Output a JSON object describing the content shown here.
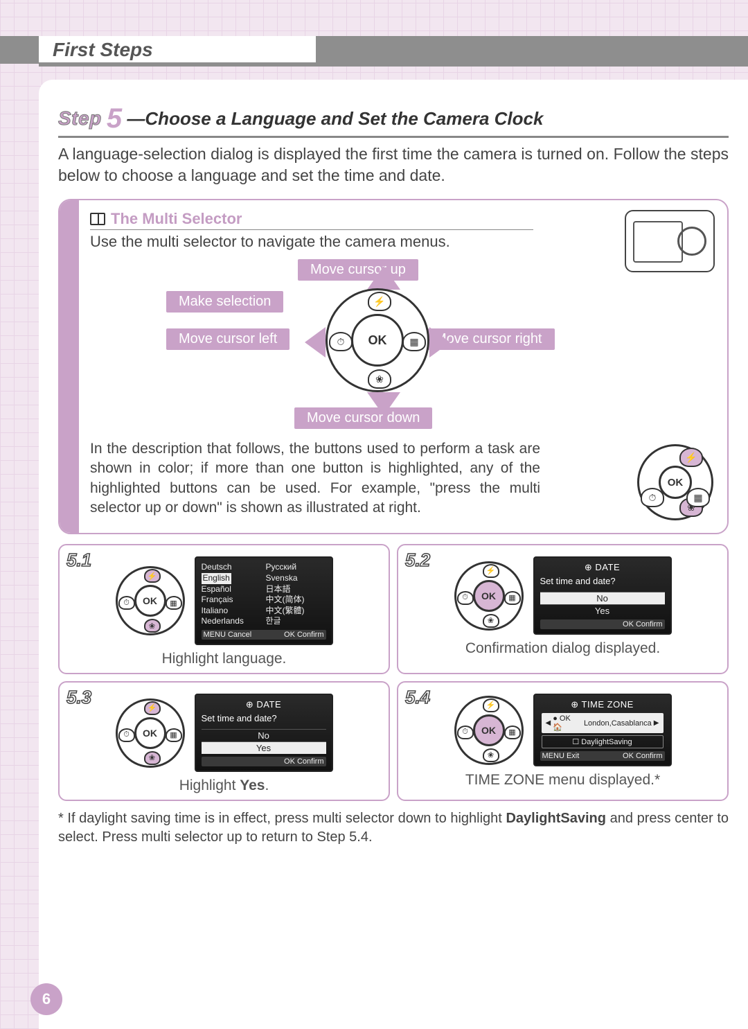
{
  "chapter": "First Steps",
  "step_word": "Step",
  "step_number": "5",
  "step_title": "—Choose a Language and Set the Camera Clock",
  "intro": "A language-selection dialog is displayed the first time the camera is turned on. Follow the steps below to choose a language and set the time and date.",
  "selector": {
    "heading": "The Multi Selector",
    "sub": "Use the multi selector to navigate the camera menus.",
    "labels": {
      "up": "Move cursor up",
      "down": "Move cursor down",
      "left": "Move cursor left",
      "right": "Move cursor right",
      "select": "Make selection"
    },
    "ok": "OK",
    "para": "In the description that follows, the buttons used to perform a task are shown in color; if more than one button is highlighted, any of the highlighted buttons can be used.  For example, \"press the multi selector up or down\" is shown as illustrated at right."
  },
  "steps": {
    "s51": {
      "num": "5.1",
      "caption": "Highlight language.",
      "lcd": {
        "col1": [
          "Deutsch",
          "English",
          "Español",
          "Français",
          "Italiano",
          "Nederlands"
        ],
        "highlight1": "English",
        "col2": [
          "Русский",
          "Svenska",
          "日本語",
          "中文(简体)",
          "中文(繁體)",
          "한글"
        ],
        "foot_left": "MENU Cancel",
        "foot_right": "OK Confirm"
      }
    },
    "s52": {
      "num": "5.2",
      "caption": "Confirmation dialog displayed.",
      "lcd": {
        "title": "DATE",
        "prompt": "Set time and date?",
        "options": [
          "No",
          "Yes"
        ],
        "highlight": "No",
        "foot_right": "OK Confirm"
      }
    },
    "s53": {
      "num": "5.3",
      "caption_pre": "Highlight ",
      "caption_bold": "Yes",
      "caption_post": ".",
      "lcd": {
        "title": "DATE",
        "prompt": "Set time and date?",
        "options": [
          "No",
          "Yes"
        ],
        "highlight": "Yes",
        "foot_right": "OK Confirm"
      }
    },
    "s54": {
      "num": "5.4",
      "caption": "TIME ZONE menu displayed.*",
      "lcd": {
        "title": "TIME ZONE",
        "tz_selected": "London,Casablanca",
        "tz_prefix": "● OK 🏠",
        "daylight": "☐ DaylightSaving",
        "foot_left": "MENU Exit",
        "foot_right": "OK Confirm"
      }
    }
  },
  "footnote_pre": "* If daylight saving time is in effect, press multi selector down to highlight ",
  "footnote_bold": "DaylightSaving",
  "footnote_post": " and press center to select.  Press multi selector up to return to Step 5.4.",
  "page_number": "6",
  "icons": {
    "timer": "⏱",
    "flash": "⚡",
    "macro": "❀",
    "mode": "▦"
  }
}
